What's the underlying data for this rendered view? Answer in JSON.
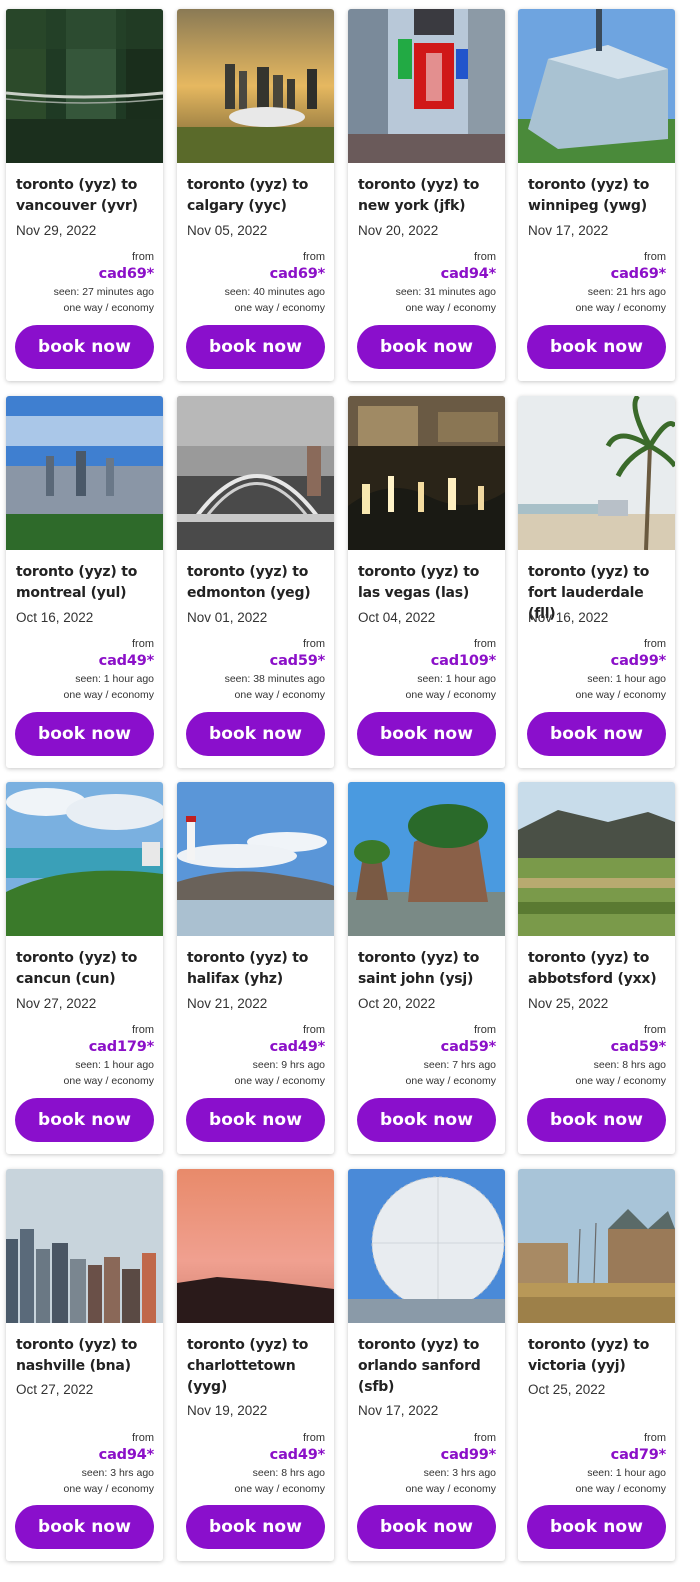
{
  "deals": [
    {
      "route": "toronto (yyz) to vancouver (yvr)",
      "date": "Nov 29, 2022",
      "from": "from",
      "price": "cad69*",
      "seen": "seen: 27 minutes ago",
      "trip": "one way / economy",
      "button": "book now",
      "image": "suspension bridge in forest"
    },
    {
      "route": "toronto (yyz) to calgary (yyc)",
      "date": "Nov 05, 2022",
      "from": "from",
      "price": "cad69*",
      "seen": "seen: 40 minutes ago",
      "trip": "one way / economy",
      "button": "book now",
      "image": "calgary skyline at sunset"
    },
    {
      "route": "toronto (yyz) to new york (jfk)",
      "date": "Nov 20, 2022",
      "from": "from",
      "price": "cad94*",
      "seen": "seen: 31 minutes ago",
      "trip": "one way / economy",
      "button": "book now",
      "image": "times square"
    },
    {
      "route": "toronto (yyz) to winnipeg (ywg)",
      "date": "Nov 17, 2022",
      "from": "from",
      "price": "cad69*",
      "seen": "seen: 21 hrs ago",
      "trip": "one way / economy",
      "button": "book now",
      "image": "human rights museum"
    },
    {
      "route": "toronto (yyz) to montreal (yul)",
      "date": "Oct 16, 2022",
      "from": "from",
      "price": "cad49*",
      "seen": "seen: 1 hour ago",
      "trip": "one way / economy",
      "button": "book now",
      "image": "montreal skyline"
    },
    {
      "route": "toronto (yyz) to edmonton (yeg)",
      "date": "Nov 01, 2022",
      "from": "from",
      "price": "cad59*",
      "seen": "seen: 38 minutes ago",
      "trip": "one way / economy",
      "button": "book now",
      "image": "arch bridge"
    },
    {
      "route": "toronto (yyz) to las vegas (las)",
      "date": "Oct 04, 2022",
      "from": "from",
      "price": "cad109*",
      "seen": "seen: 1 hour ago",
      "trip": "one way / economy",
      "button": "book now",
      "image": "bellagio fountains at night"
    },
    {
      "route": "toronto (yyz) to fort lauderdale (fll)",
      "date": "Nov 16, 2022",
      "from": "from",
      "price": "cad99*",
      "seen": "seen: 1 hour ago",
      "trip": "one way / economy",
      "button": "book now",
      "image": "palm tree beach"
    },
    {
      "route": "toronto (yyz) to cancun (cun)",
      "date": "Nov 27, 2022",
      "from": "from",
      "price": "cad179*",
      "seen": "seen: 1 hour ago",
      "trip": "one way / economy",
      "button": "book now",
      "image": "tropical coast"
    },
    {
      "route": "toronto (yyz) to halifax (yhz)",
      "date": "Nov 21, 2022",
      "from": "from",
      "price": "cad49*",
      "seen": "seen: 9 hrs ago",
      "trip": "one way / economy",
      "button": "book now",
      "image": "lighthouse on rocks"
    },
    {
      "route": "toronto (yyz) to saint john (ysj)",
      "date": "Oct 20, 2022",
      "from": "from",
      "price": "cad59*",
      "seen": "seen: 7 hrs ago",
      "trip": "one way / economy",
      "button": "book now",
      "image": "flowerpot rocks"
    },
    {
      "route": "toronto (yyz) to abbotsford (yxx)",
      "date": "Nov 25, 2022",
      "from": "from",
      "price": "cad59*",
      "seen": "seen: 8 hrs ago",
      "trip": "one way / economy",
      "button": "book now",
      "image": "valley farmland"
    },
    {
      "route": "toronto (yyz) to nashville (bna)",
      "date": "Oct 27, 2022",
      "from": "from",
      "price": "cad94*",
      "seen": "seen: 3 hrs ago",
      "trip": "one way / economy",
      "button": "book now",
      "image": "nashville skyline"
    },
    {
      "route": "toronto (yyz) to charlottetown (yyg)",
      "date": "Nov 19, 2022",
      "from": "from",
      "price": "cad49*",
      "seen": "seen: 8 hrs ago",
      "trip": "one way / economy",
      "button": "book now",
      "image": "pink sunset coast"
    },
    {
      "route": "toronto (yyz) to orlando sanford (sfb)",
      "date": "Nov 17, 2022",
      "from": "from",
      "price": "cad99*",
      "seen": "seen: 3 hrs ago",
      "trip": "one way / economy",
      "button": "book now",
      "image": "geodesic sphere"
    },
    {
      "route": "toronto (yyz) to victoria (yyj)",
      "date": "Oct 25, 2022",
      "from": "from",
      "price": "cad79*",
      "seen": "seen: 1 hour ago",
      "trip": "one way / economy",
      "button": "book now",
      "image": "harbour with sailboats"
    }
  ],
  "colors": {
    "accent": "#8a0fcc",
    "price": "#8b10c8"
  }
}
